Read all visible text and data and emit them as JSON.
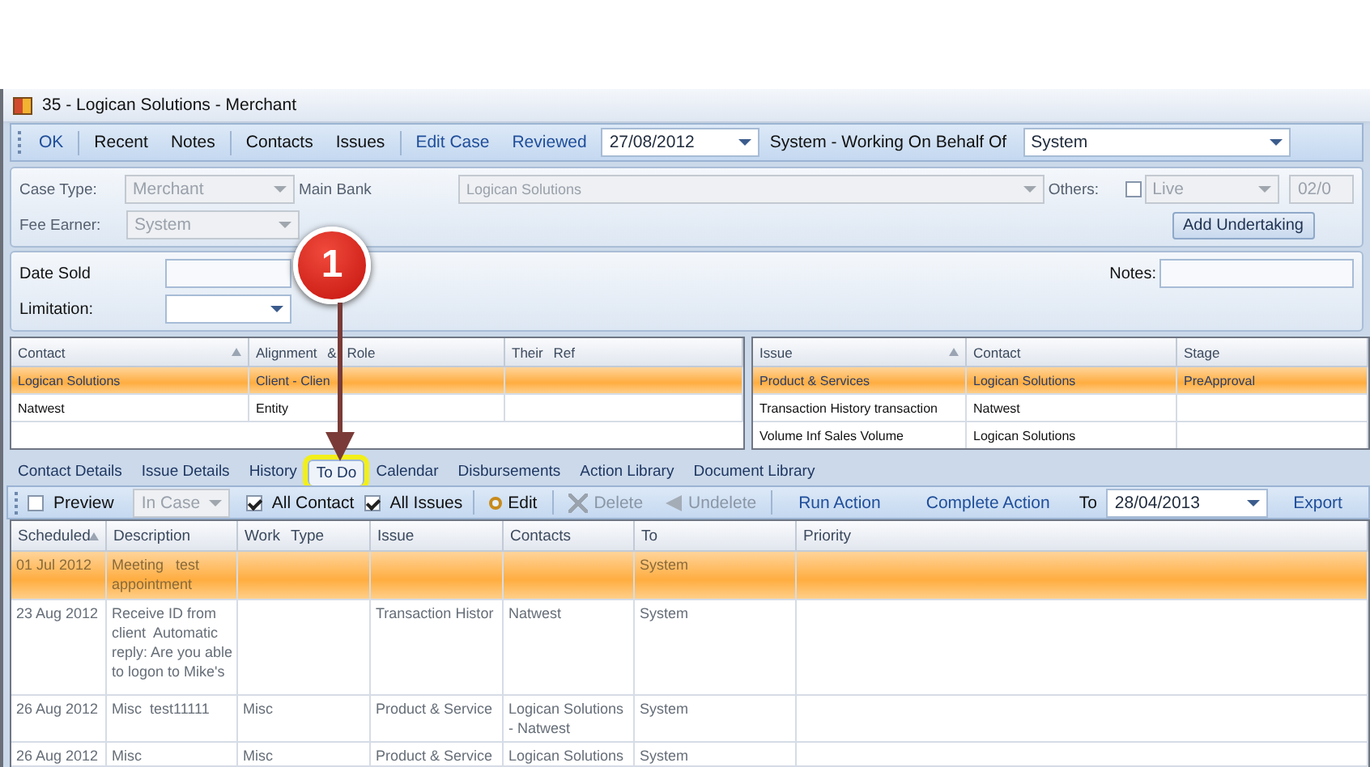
{
  "window": {
    "title": "35 - Logican Solutions - Merchant"
  },
  "toolbar": {
    "items": [
      {
        "label": "OK",
        "kind": "link"
      },
      {
        "label": "Recent",
        "kind": "plain"
      },
      {
        "label": "Notes",
        "kind": "plain"
      },
      {
        "label": "Contacts",
        "kind": "plain"
      },
      {
        "label": "Issues",
        "kind": "plain"
      },
      {
        "label": "Edit Case",
        "kind": "link"
      },
      {
        "label": "Reviewed",
        "kind": "link"
      }
    ],
    "reviewed_date": "27/08/2012",
    "working_label": "System  - Working On Behalf Of",
    "working_value": "System"
  },
  "case_form": {
    "case_type_label": "Case Type:",
    "case_type": "Merchant",
    "main_bank_label": "Main Bank",
    "main_bank": "Logican Solutions",
    "others_label": "Others:",
    "others_checked": false,
    "status": "Live",
    "date": "02/0",
    "fee_earner_label": "Fee Earner:",
    "fee_earner": "System",
    "add_undertaking": "Add Undertaking"
  },
  "sale_form": {
    "date_sold_label": "Date Sold",
    "limitation_label": "Limitation:",
    "notes_label": "Notes:"
  },
  "contacts_grid": {
    "columns": [
      "Contact",
      "Alignment & Role",
      "Their Ref"
    ],
    "rows": [
      {
        "cells": [
          "Logican Solutions",
          "Client - Clien",
          ""
        ],
        "selected": true
      },
      {
        "cells": [
          "Natwest",
          "Entity",
          ""
        ],
        "selected": false
      }
    ]
  },
  "issues_grid": {
    "columns": [
      "Issue",
      "Contact",
      "Stage"
    ],
    "rows": [
      {
        "cells": [
          "Product & Services",
          "Logican Solutions",
          "PreApproval"
        ],
        "selected": true
      },
      {
        "cells": [
          "Transaction History transaction",
          "Natwest",
          ""
        ],
        "selected": false
      },
      {
        "cells": [
          "Volume Inf Sales Volume",
          "Logican Solutions",
          ""
        ],
        "selected": false
      }
    ]
  },
  "tabs": [
    {
      "label": "Contact Details",
      "selected": false,
      "highlighted": false
    },
    {
      "label": "Issue Details",
      "selected": false,
      "highlighted": false
    },
    {
      "label": "History",
      "selected": false,
      "highlighted": false
    },
    {
      "label": "To Do",
      "selected": true,
      "highlighted": true
    },
    {
      "label": "Calendar",
      "selected": false,
      "highlighted": false
    },
    {
      "label": "Disbursements",
      "selected": false,
      "highlighted": false
    },
    {
      "label": "Action Library",
      "selected": false,
      "highlighted": false
    },
    {
      "label": "Document Library",
      "selected": false,
      "highlighted": false
    }
  ],
  "todo_toolbar": {
    "preview": {
      "label": "Preview",
      "checked": false
    },
    "in_case": "In Case",
    "all_contact": {
      "label": "All Contact",
      "checked": true
    },
    "all_issues": {
      "label": "All Issues",
      "checked": true
    },
    "edit": "Edit",
    "delete": "Delete",
    "undelete": "Undelete",
    "run_action": "Run Action",
    "complete_action": "Complete Action",
    "to_label": "To",
    "to_date": "28/04/2013",
    "export": "Export"
  },
  "todo_table": {
    "columns": [
      "Scheduled",
      "Description",
      "Work Type",
      "Issue",
      "Contacts",
      "To",
      "Priority"
    ],
    "rows": [
      {
        "cells": [
          "01 Jul 2012",
          "Meeting   test appointment",
          "",
          "",
          "",
          "System",
          ""
        ],
        "selected": true
      },
      {
        "cells": [
          "23 Aug 2012",
          "Receive ID from client  Automatic reply: Are you able to logon to Mike's",
          "",
          "Transaction Histor",
          "Natwest",
          "System",
          ""
        ],
        "selected": false
      },
      {
        "cells": [
          "26 Aug 2012",
          "Misc  test11111",
          "Misc",
          "Product & Service",
          "Logican Solutions - Natwest",
          "System",
          ""
        ],
        "selected": false
      },
      {
        "cells": [
          "26 Aug 2012",
          "Misc",
          "Misc",
          "Product & Service",
          "Logican Solutions",
          "System",
          ""
        ],
        "selected": false
      }
    ]
  },
  "callout": {
    "number": "1"
  }
}
